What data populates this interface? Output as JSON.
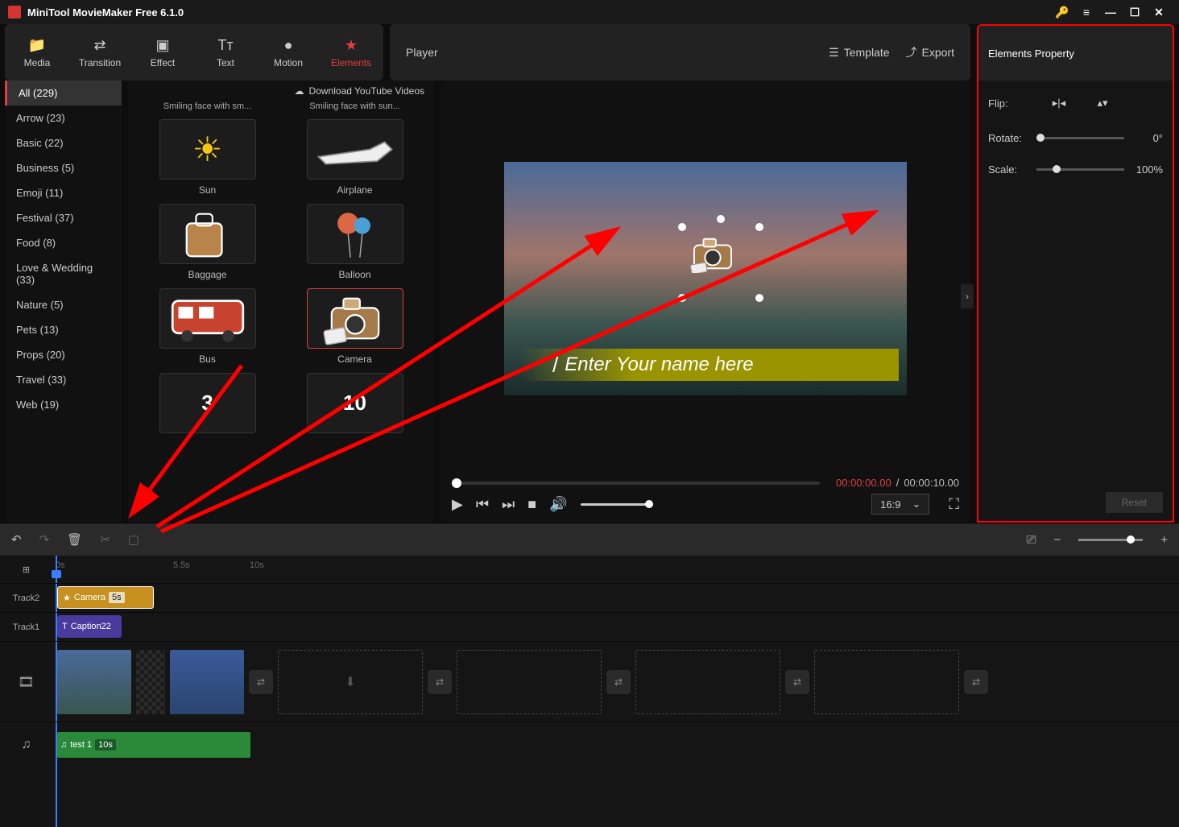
{
  "title": "MiniTool MovieMaker Free 6.1.0",
  "nav": [
    {
      "label": "Media",
      "icon": "📁"
    },
    {
      "label": "Transition",
      "icon": "⇄"
    },
    {
      "label": "Effect",
      "icon": "▣"
    },
    {
      "label": "Text",
      "icon": "Tᴛ"
    },
    {
      "label": "Motion",
      "icon": "●"
    },
    {
      "label": "Elements",
      "icon": "★",
      "active": true
    }
  ],
  "player_title": "Player",
  "template_label": "Template",
  "export_label": "Export",
  "prop_title": "Elements Property",
  "categories": [
    {
      "label": "All (229)",
      "active": true
    },
    {
      "label": "Arrow (23)"
    },
    {
      "label": "Basic (22)"
    },
    {
      "label": "Business (5)"
    },
    {
      "label": "Emoji (11)"
    },
    {
      "label": "Festival (37)"
    },
    {
      "label": "Food (8)"
    },
    {
      "label": "Love & Wedding (33)"
    },
    {
      "label": "Nature (5)"
    },
    {
      "label": "Pets (13)"
    },
    {
      "label": "Props (20)"
    },
    {
      "label": "Travel (33)"
    },
    {
      "label": "Web (19)"
    }
  ],
  "top_cut": [
    "Smiling face with sm...",
    "Smiling face with sun..."
  ],
  "dl_label": "Download YouTube Videos",
  "elements": [
    {
      "label": "Sun"
    },
    {
      "label": "Airplane"
    },
    {
      "label": "Baggage"
    },
    {
      "label": "Balloon"
    },
    {
      "label": "Bus"
    },
    {
      "label": "Camera",
      "selected": true
    }
  ],
  "countdown": [
    "3",
    "10"
  ],
  "preview": {
    "name_placeholder": "Enter Your name here",
    "pre": "/"
  },
  "time": {
    "current": "00:00:00.00",
    "sep": "/",
    "total": "00:00:10.00"
  },
  "ratio": "16:9",
  "props": {
    "flip": "Flip:",
    "rotate": "Rotate:",
    "rotate_val": "0°",
    "scale": "Scale:",
    "scale_val": "100%",
    "reset": "Reset"
  },
  "timeline": {
    "ticks": {
      "t0": "0s",
      "t1": "5.5s",
      "t2": "10s"
    },
    "tracks": {
      "t2": "Track2",
      "t1": "Track1"
    },
    "camera": {
      "name": "Camera",
      "dur": "5s"
    },
    "caption": "Caption22",
    "audio": {
      "name": "test 1",
      "dur": "10s"
    }
  }
}
